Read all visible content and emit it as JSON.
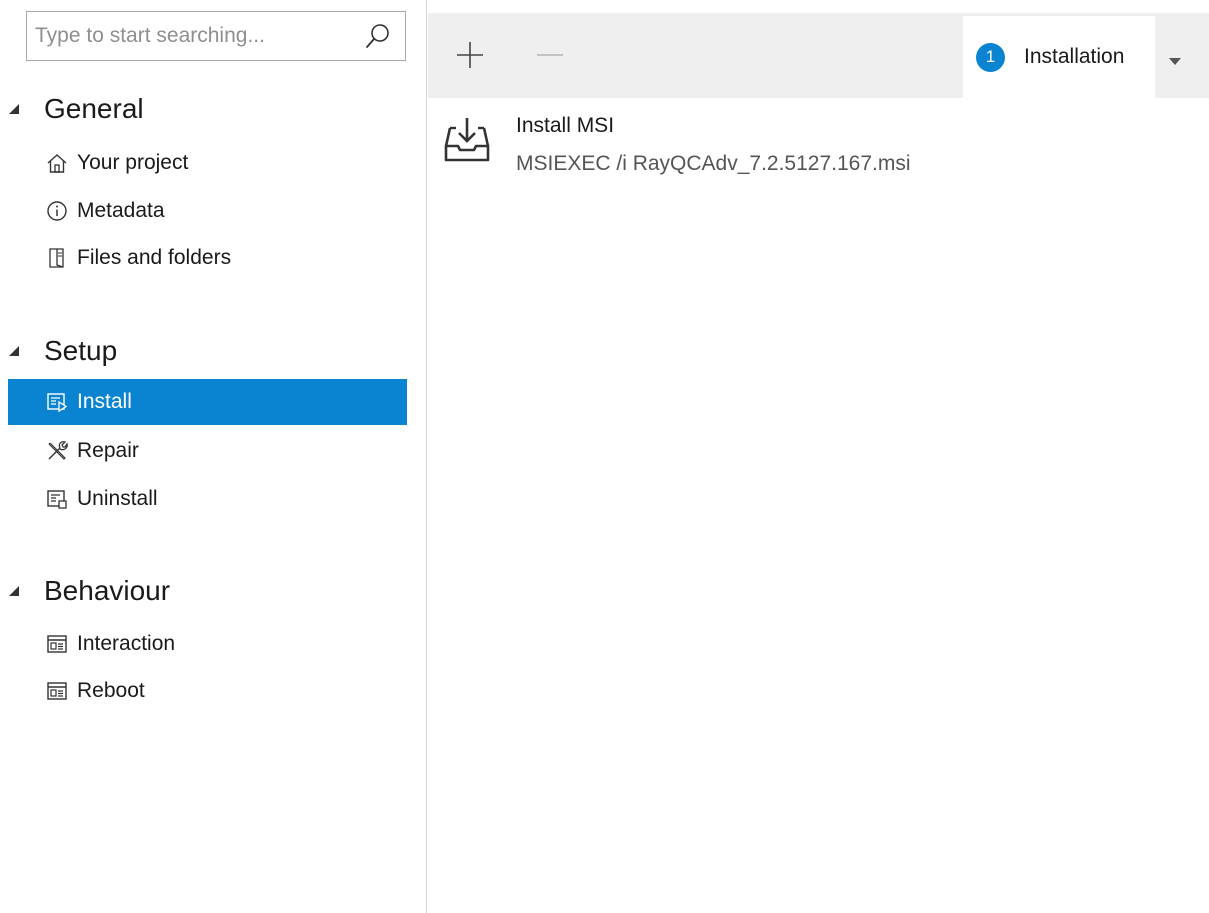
{
  "search": {
    "placeholder": "Type to start searching...",
    "value": ""
  },
  "sidebar": {
    "sections": [
      {
        "title": "General",
        "items": [
          {
            "label": "Your project",
            "icon": "home-icon"
          },
          {
            "label": "Metadata",
            "icon": "info-icon"
          },
          {
            "label": "Files and folders",
            "icon": "files-icon"
          }
        ]
      },
      {
        "title": "Setup",
        "items": [
          {
            "label": "Install",
            "icon": "install-icon",
            "selected": true
          },
          {
            "label": "Repair",
            "icon": "repair-icon"
          },
          {
            "label": "Uninstall",
            "icon": "uninstall-icon"
          }
        ]
      },
      {
        "title": "Behaviour",
        "items": [
          {
            "label": "Interaction",
            "icon": "window-icon"
          },
          {
            "label": "Reboot",
            "icon": "window-icon"
          }
        ]
      }
    ]
  },
  "toolbar": {
    "add_icon": "plus-icon",
    "remove_icon": "minus-icon",
    "tab": {
      "badge": "1",
      "label": "Installation"
    },
    "dropdown_icon": "caret-down-icon"
  },
  "main": {
    "actions": [
      {
        "title": "Install MSI",
        "command": "MSIEXEC /i RayQCAdv_7.2.5127.167.msi",
        "icon": "install-msi-icon"
      }
    ]
  },
  "colors": {
    "accent": "#0a84d0",
    "toolbar_bg": "#efefef",
    "muted_text": "#555555"
  }
}
